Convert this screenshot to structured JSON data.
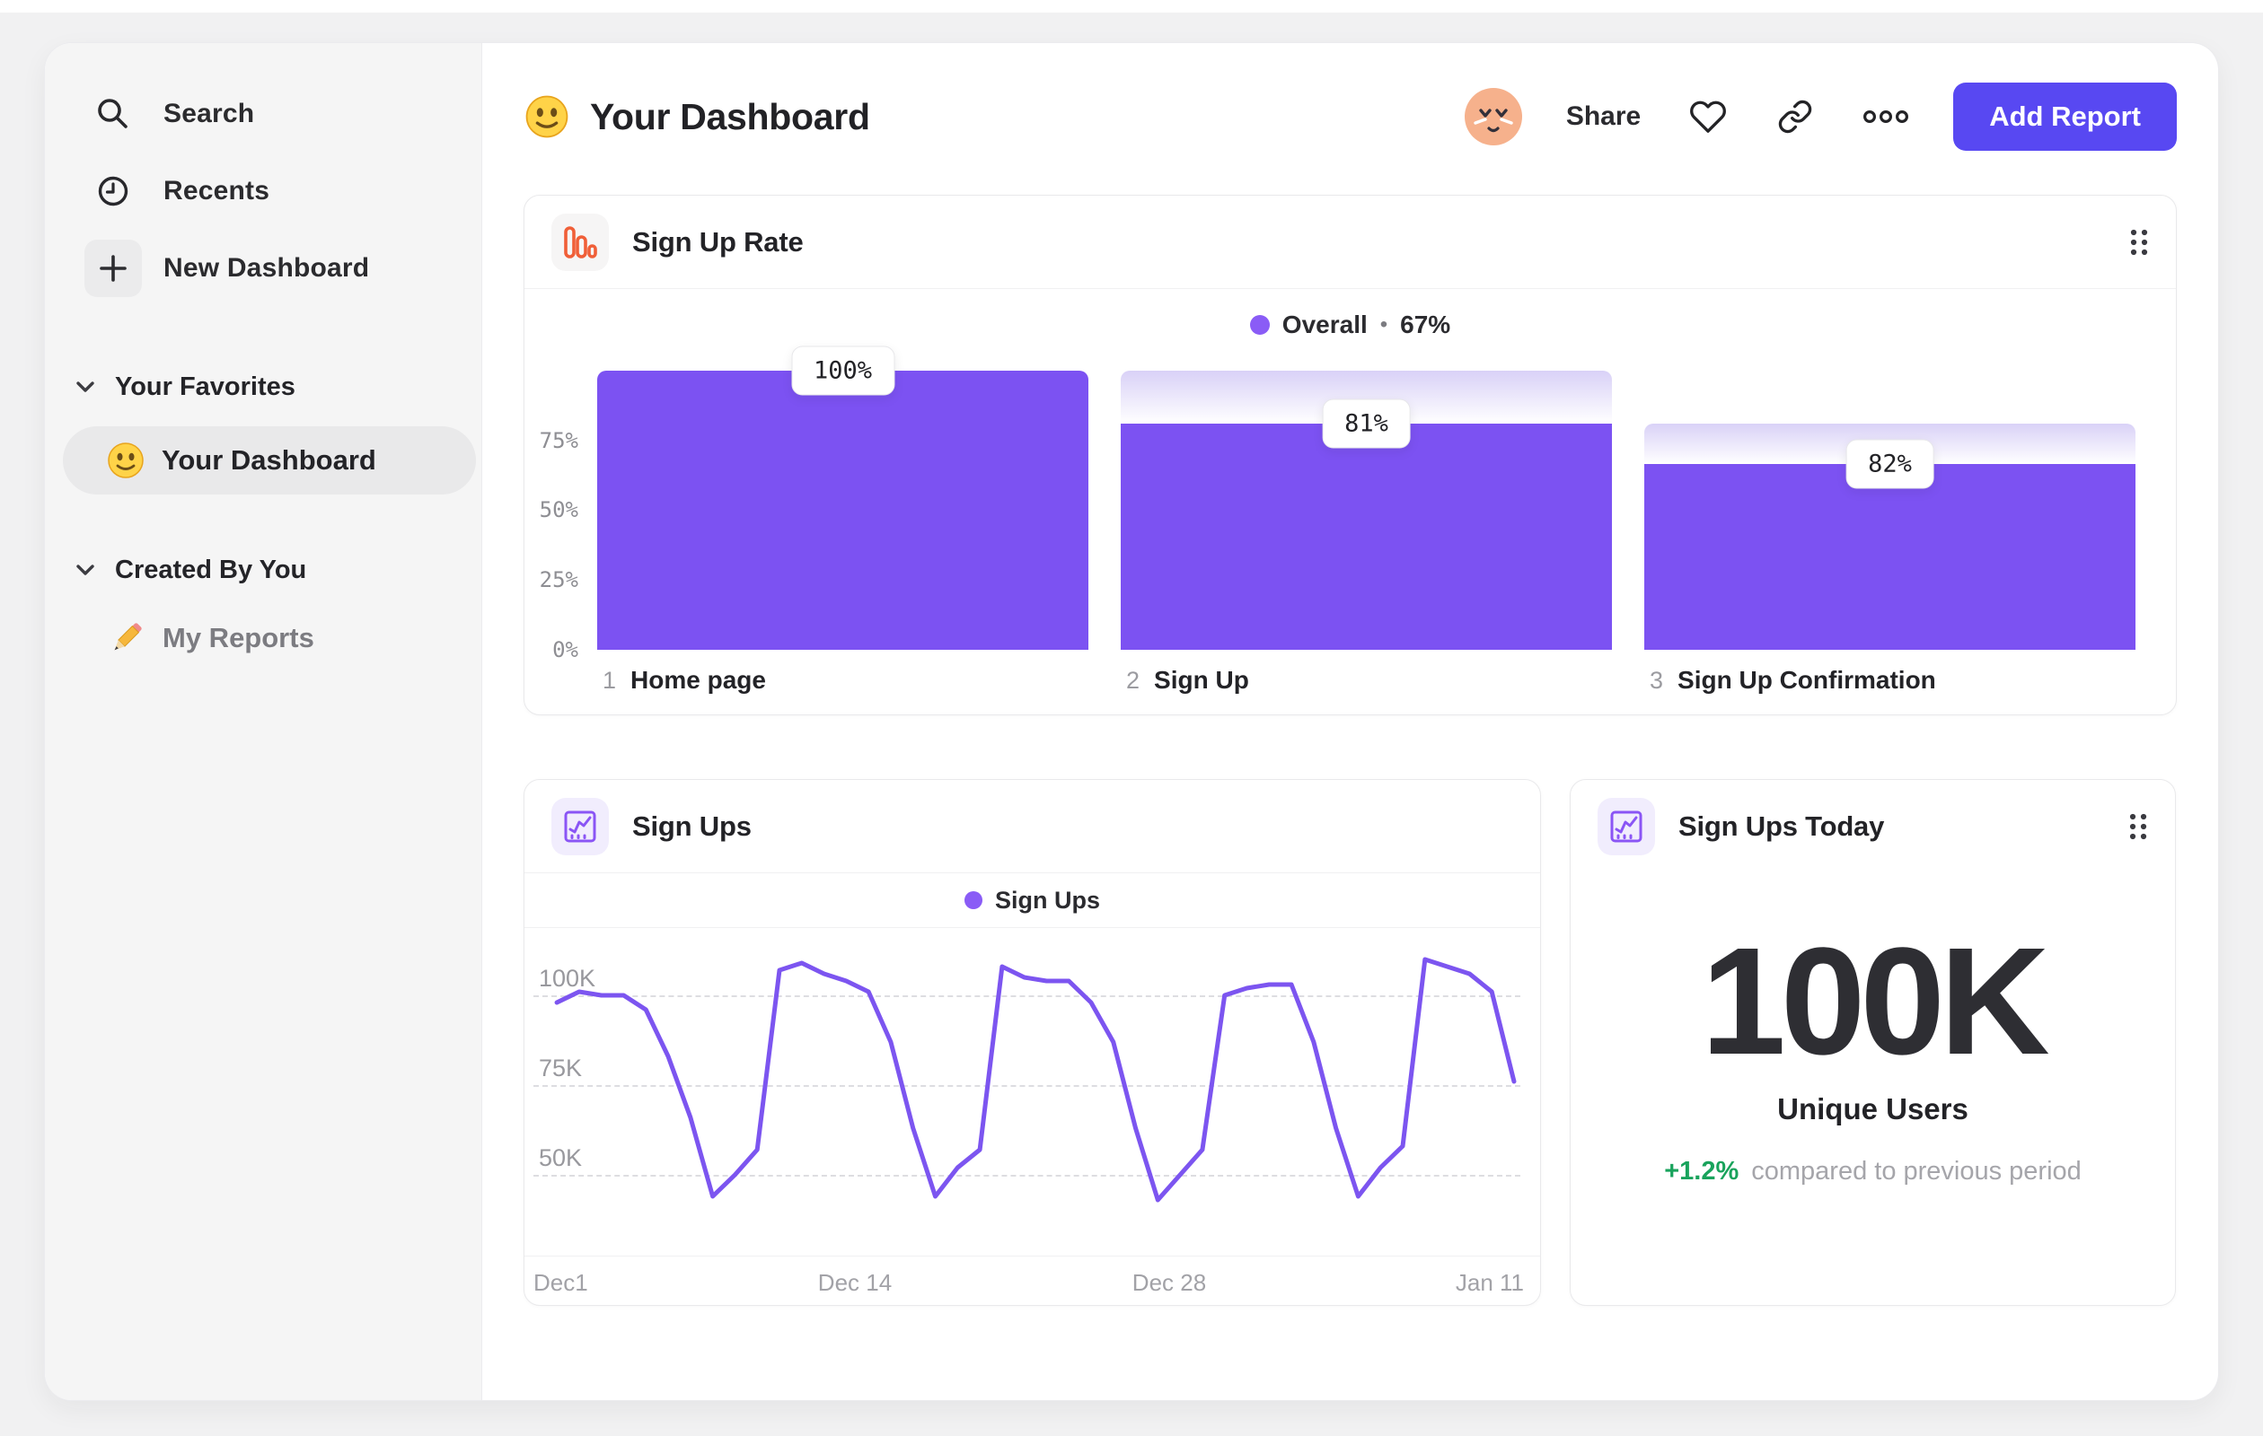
{
  "header": {
    "title": "Your Dashboard",
    "actions": {
      "share": "Share",
      "add_report": "Add Report"
    }
  },
  "sidebar": {
    "nav": [
      {
        "label": "Search"
      },
      {
        "label": "Recents"
      },
      {
        "label": "New Dashboard"
      }
    ],
    "sections": [
      {
        "title": "Your Favorites",
        "items": [
          {
            "label": "Your Dashboard",
            "active": true
          }
        ]
      },
      {
        "title": "Created By You",
        "items": [
          {
            "label": "My Reports",
            "active": false
          }
        ]
      }
    ]
  },
  "cards": {
    "funnel": {
      "title": "Sign Up Rate",
      "legend_label": "Overall",
      "legend_separator": "•",
      "legend_value": "67%"
    },
    "line": {
      "title": "Sign Ups",
      "legend_label": "Sign Ups"
    },
    "metric": {
      "title": "Sign Ups Today",
      "value": "100K",
      "label": "Unique Users",
      "delta": "+1.2%",
      "delta_caption": "compared to previous period"
    }
  },
  "chart_data": [
    {
      "type": "bar",
      "title": "Sign Up Rate",
      "categories": [
        "Home page",
        "Sign Up",
        "Sign Up Confirmation"
      ],
      "values": [
        100,
        81,
        82
      ],
      "value_labels": [
        "100%",
        "81%",
        "82%"
      ],
      "overall_conversion": "67%",
      "y_ticks": [
        "75%",
        "50%",
        "25%",
        "0%"
      ],
      "ylim": [
        0,
        100
      ],
      "legend_position": "top-center",
      "bar_color": "#7c52f2",
      "ghost_top_color": "#d9d1f7",
      "note": "funnel; each value is conversion from previous step, ghost gradient shows drop-off"
    },
    {
      "type": "line",
      "title": "Sign Ups",
      "series": [
        {
          "name": "Sign Ups",
          "color": "#7c55f0",
          "values_unit": "thousands",
          "values": [
            98,
            101,
            100,
            100,
            96,
            83,
            66,
            44,
            50,
            57,
            107,
            109,
            106,
            104,
            101,
            87,
            63,
            44,
            52,
            57,
            108,
            105,
            104,
            104,
            98,
            87,
            63,
            43,
            50,
            57,
            100,
            102,
            103,
            103,
            87,
            63,
            44,
            52,
            58,
            110,
            108,
            106,
            101,
            76
          ]
        }
      ],
      "x_tick_labels": [
        "Dec1",
        "Dec 14",
        "Dec 28",
        "Jan 11"
      ],
      "y_ticks": [
        "100K",
        "75K",
        "50K"
      ],
      "ylim": [
        35,
        115
      ],
      "grid": "dashed horizontal",
      "legend_position": "top-center"
    }
  ],
  "colors": {
    "accent_purple": "#7c52f2",
    "legend_dot": "#8a5cf6",
    "button_indigo": "#5848f2",
    "icon_orange": "#ef5f38",
    "positive_green": "#19a35c"
  }
}
